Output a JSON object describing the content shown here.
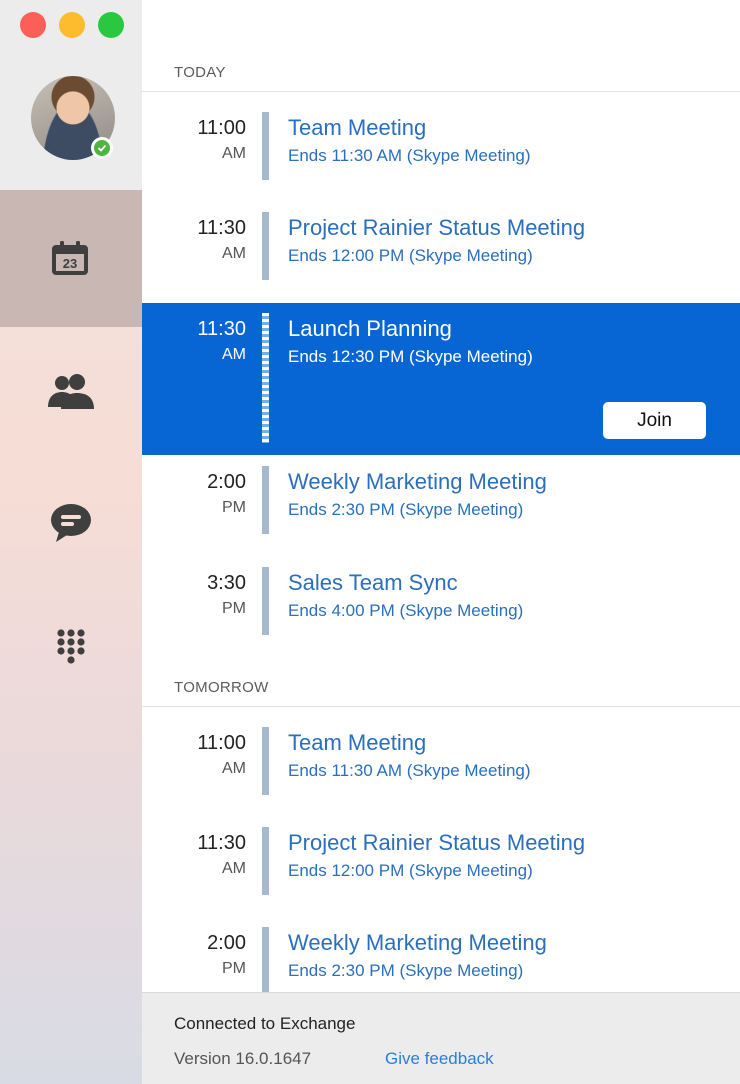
{
  "sidebar": {
    "items": [
      {
        "name": "calendar",
        "icon": "calendar-icon",
        "badge": "23",
        "selected": true
      },
      {
        "name": "contacts",
        "icon": "contacts-icon"
      },
      {
        "name": "chat",
        "icon": "chat-icon"
      },
      {
        "name": "dialpad",
        "icon": "dialpad-icon"
      }
    ],
    "presence": "available"
  },
  "sections": [
    {
      "label": "TODAY",
      "events": [
        {
          "time": "11:00",
          "ampm": "AM",
          "title": "Team Meeting",
          "subtitle": "Ends 11:30 AM (Skype Meeting)"
        },
        {
          "time": "11:30",
          "ampm": "AM",
          "title": "Project Rainier Status Meeting",
          "subtitle": "Ends 12:00 PM (Skype Meeting)"
        },
        {
          "time": "11:30",
          "ampm": "AM",
          "title": "Launch Planning",
          "subtitle": "Ends 12:30 PM (Skype Meeting)",
          "selected": true,
          "action": "Join"
        },
        {
          "time": "2:00",
          "ampm": "PM",
          "title": "Weekly Marketing Meeting",
          "subtitle": "Ends 2:30 PM (Skype Meeting)"
        },
        {
          "time": "3:30",
          "ampm": "PM",
          "title": "Sales Team Sync",
          "subtitle": "Ends 4:00 PM (Skype Meeting)"
        }
      ]
    },
    {
      "label": "TOMORROW",
      "events": [
        {
          "time": "11:00",
          "ampm": "AM",
          "title": "Team Meeting",
          "subtitle": "Ends 11:30 AM (Skype Meeting)"
        },
        {
          "time": "11:30",
          "ampm": "AM",
          "title": "Project Rainier Status Meeting",
          "subtitle": "Ends 12:00 PM (Skype Meeting)"
        },
        {
          "time": "2:00",
          "ampm": "PM",
          "title": "Weekly Marketing Meeting",
          "subtitle": "Ends 2:30 PM (Skype Meeting)"
        }
      ]
    }
  ],
  "footer": {
    "status": "Connected to Exchange",
    "version": "Version 16.0.1647",
    "feedback_label": "Give feedback"
  },
  "colors": {
    "accent": "#0866d4",
    "link": "#2a6fbd",
    "presence": "#4fb443"
  }
}
